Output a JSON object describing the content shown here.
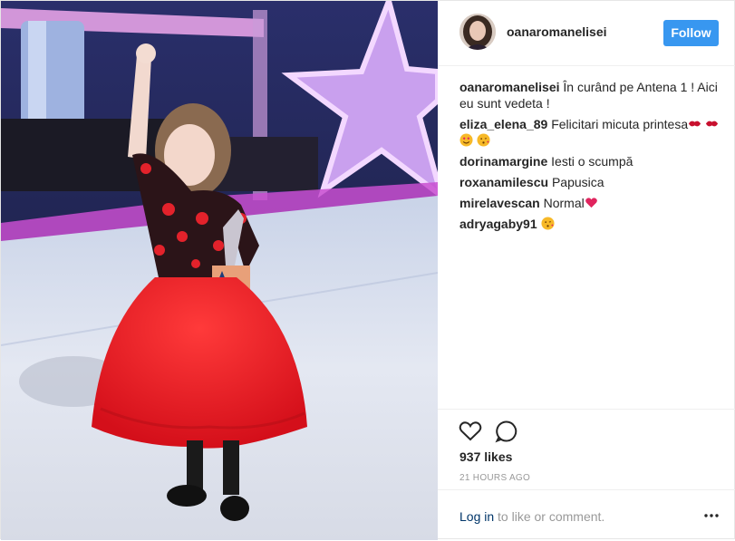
{
  "post": {
    "username": "oanaromanelisei",
    "follow_label": "Follow",
    "caption": {
      "user": "oanaromanelisei",
      "text": "În curând pe Antena 1 ! Aici eu sunt vedeta !"
    },
    "comments": [
      {
        "user": "eliza_elena_89",
        "text": "Felicitari micuta printesa",
        "emoji_after": [
          "kiss-mark",
          "kiss-mark",
          "heart-eyes",
          "face-blowing-kiss"
        ]
      },
      {
        "user": "dorinamargine",
        "text": "Iesti o scumpă",
        "emoji_after": []
      },
      {
        "user": "roxanamilescu",
        "text": "Papusica",
        "emoji_after": []
      },
      {
        "user": "mirelavescan",
        "text": "Normal",
        "emoji_after": [
          "red-heart"
        ]
      },
      {
        "user": "adryagaby91",
        "text": "",
        "emoji_after": [
          "face-blowing-kiss"
        ]
      }
    ],
    "likes_label": "937 likes",
    "time_label": "21 HOURS AGO",
    "login_link": "Log in",
    "login_rest": " to like or comment.",
    "icons": [
      "heart-outline-icon",
      "comment-bubble-icon",
      "more-options-icon"
    ],
    "colors": {
      "follow": "#3897f0",
      "link": "#003569",
      "muted": "#999999"
    }
  }
}
